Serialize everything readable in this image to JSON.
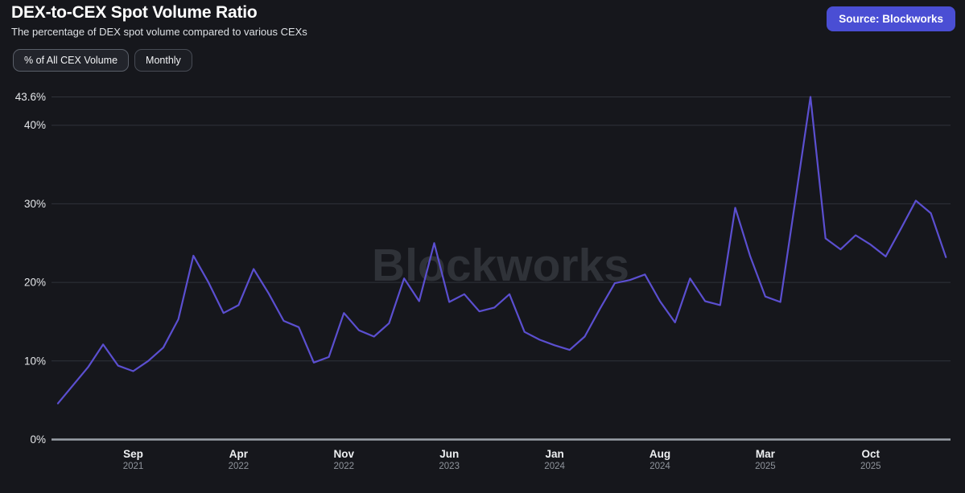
{
  "header": {
    "title": "DEX-to-CEX Spot Volume Ratio",
    "subtitle": "The percentage of DEX spot volume compared to various CEXs",
    "source_button": "Source: Blockworks"
  },
  "filters": [
    {
      "label": "% of All CEX Volume",
      "active": true
    },
    {
      "label": "Monthly",
      "active": false
    }
  ],
  "watermark": "Blockworks",
  "colors": {
    "background": "#16171c",
    "line": "#5b4fd0",
    "accent_button": "#4a4ed4",
    "grid": "#2f323a",
    "axis_baseline": "#9aa0a8",
    "watermark": "#2f3238",
    "y_label": "#e4e6e9",
    "month_label": "#eef0f2",
    "year_label": "#8f949c"
  },
  "chart_data": {
    "type": "line",
    "title": "DEX-to-CEX Spot Volume Ratio",
    "unit": "%",
    "ylim": [
      0,
      43.6
    ],
    "y_ticks": [
      0,
      10,
      20,
      30,
      40,
      43.6
    ],
    "y_tick_labels": [
      "0%",
      "10%",
      "20%",
      "30%",
      "40%",
      "43.6%"
    ],
    "max_label": "43.6%",
    "grid": "horizontal",
    "legend_position": "none",
    "x_ticks": [
      {
        "index": 5,
        "month": "Sep",
        "year": "2021"
      },
      {
        "index": 12,
        "month": "Apr",
        "year": "2022"
      },
      {
        "index": 19,
        "month": "Nov",
        "year": "2022"
      },
      {
        "index": 26,
        "month": "Jun",
        "year": "2023"
      },
      {
        "index": 33,
        "month": "Jan",
        "year": "2024"
      },
      {
        "index": 40,
        "month": "Aug",
        "year": "2024"
      },
      {
        "index": 47,
        "month": "Mar",
        "year": "2025"
      },
      {
        "index": 54,
        "month": "Oct",
        "year": "2025"
      }
    ],
    "values": [
      4.6,
      6.9,
      9.2,
      12.1,
      9.4,
      8.7,
      10.0,
      11.7,
      15.3,
      23.4,
      20.0,
      16.1,
      17.1,
      21.7,
      18.6,
      15.1,
      14.3,
      9.8,
      10.5,
      16.1,
      13.9,
      13.1,
      14.8,
      20.5,
      17.6,
      25.0,
      17.5,
      18.5,
      16.3,
      16.8,
      18.5,
      13.7,
      12.7,
      12.0,
      11.4,
      13.1,
      16.6,
      19.9,
      20.3,
      21.0,
      17.6,
      14.9,
      20.5,
      17.6,
      17.1,
      29.5,
      23.3,
      18.2,
      17.5,
      30.5,
      43.6,
      25.6,
      24.2,
      26.0,
      24.8,
      23.3,
      26.8,
      30.4,
      28.8,
      23.2
    ]
  }
}
